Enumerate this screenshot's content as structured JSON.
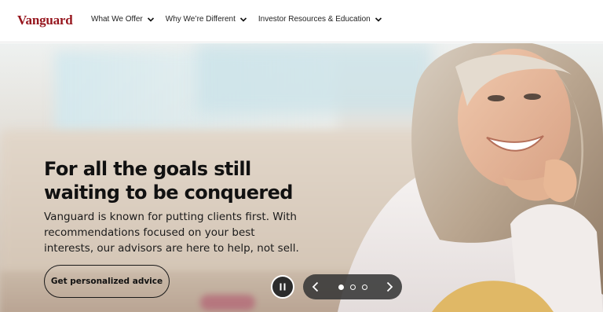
{
  "header": {
    "logo": "Vanguard",
    "nav": [
      {
        "label": "What We Offer",
        "icon": "chevron-down-icon"
      },
      {
        "label": "Why We’re Different",
        "icon": "chevron-down-icon"
      },
      {
        "label": "Investor Resources & Education",
        "icon": "chevron-down-icon"
      }
    ]
  },
  "hero": {
    "headline_line1": "For all the goals still",
    "headline_line2": "waiting to be conquered",
    "subcopy_line1": "Vanguard is known for putting clients first. With",
    "subcopy_line2": "recommendations focused on your best",
    "subcopy_line3": "interests, our advisors are here to help, not sell.",
    "cta_label": "Get personalized advice"
  },
  "carousel": {
    "pause_icon": "pause-icon",
    "prev_icon": "chevron-left-icon",
    "next_icon": "chevron-right-icon",
    "slide_count": 3,
    "active_index": 0
  },
  "colors": {
    "brand": "#96151d",
    "text": "#111111",
    "control_bg": "#373737"
  }
}
